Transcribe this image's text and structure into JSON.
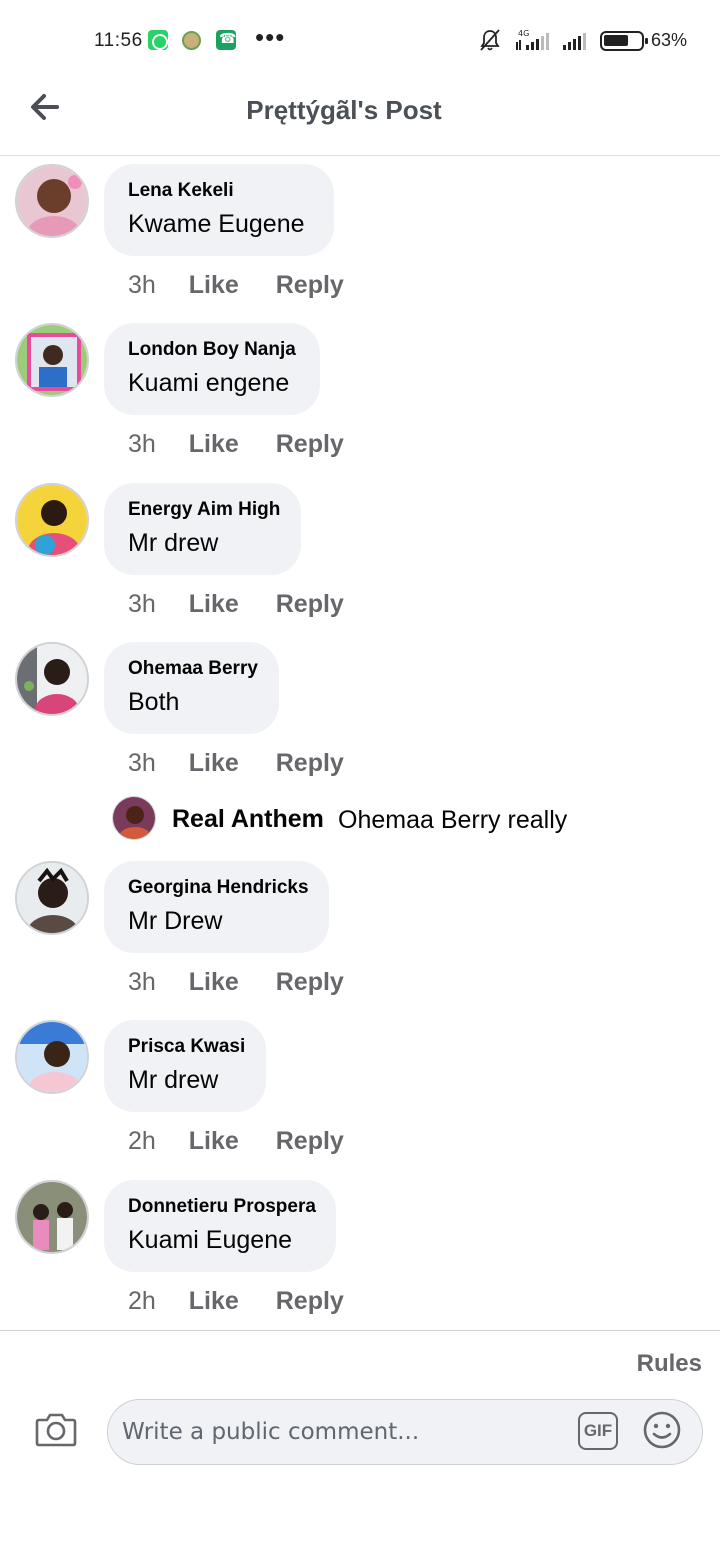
{
  "status_bar": {
    "time": "11:56",
    "battery_percent": "63%",
    "network": "4G",
    "icons": [
      "whatsapp-icon",
      "app-icon",
      "phone-icon",
      "more-dots-icon",
      "bell-muted-icon",
      "signal-icon",
      "signal-icon",
      "battery-icon"
    ]
  },
  "header": {
    "back_icon": "arrow-left-icon",
    "title": "Pręttýgãl's Post"
  },
  "comments": [
    {
      "author": "Lena Kekeli",
      "text": "Kwame Eugene",
      "time": "3h",
      "like": "Like",
      "reply": "Reply"
    },
    {
      "author": "London Boy Nanja",
      "text": "Kuami engene",
      "time": "3h",
      "like": "Like",
      "reply": "Reply"
    },
    {
      "author": "Energy Aim High",
      "text": "Mr drew",
      "time": "3h",
      "like": "Like",
      "reply": "Reply"
    },
    {
      "author": "Ohemaa Berry",
      "text": "Both",
      "time": "3h",
      "like": "Like",
      "reply": "Reply"
    },
    {
      "author": "Georgina Hendricks",
      "text": "Mr Drew",
      "time": "3h",
      "like": "Like",
      "reply": "Reply"
    },
    {
      "author": "Prisca Kwasi",
      "text": "Mr drew",
      "time": "2h",
      "like": "Like",
      "reply": "Reply"
    },
    {
      "author": "Donnetieru Prospera",
      "text": "Kuami Eugene",
      "time": "2h",
      "like": "Like",
      "reply": "Reply"
    }
  ],
  "reply_preview": {
    "author": "Real Anthem",
    "text": "Ohemaa Berry really"
  },
  "composer": {
    "rules_label": "Rules",
    "placeholder": "Write a public comment...",
    "gif_label": "GIF",
    "camera_icon": "camera-icon",
    "emoji_icon": "smiley-icon"
  },
  "colors": {
    "bubble": "#f0f2f5",
    "secondary_text": "#65676b",
    "header_text": "#4b4f56"
  }
}
